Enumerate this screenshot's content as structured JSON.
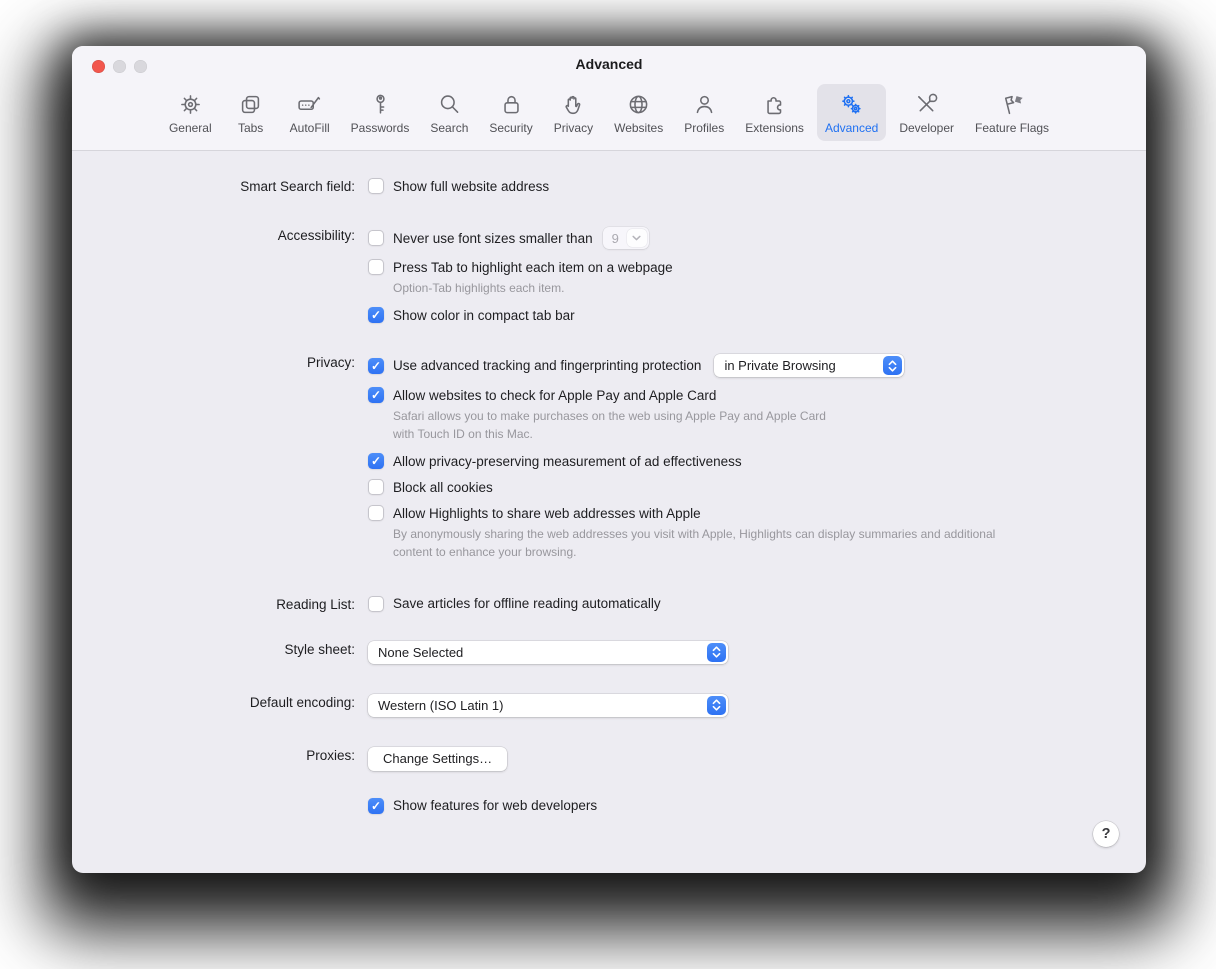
{
  "window": {
    "title": "Advanced"
  },
  "toolbar": {
    "items": [
      {
        "label": "General",
        "icon": "gear-icon",
        "selected": false
      },
      {
        "label": "Tabs",
        "icon": "tabs-icon",
        "selected": false
      },
      {
        "label": "AutoFill",
        "icon": "autofill-icon",
        "selected": false
      },
      {
        "label": "Passwords",
        "icon": "key-icon",
        "selected": false
      },
      {
        "label": "Search",
        "icon": "search-icon",
        "selected": false
      },
      {
        "label": "Security",
        "icon": "lock-icon",
        "selected": false
      },
      {
        "label": "Privacy",
        "icon": "hand-icon",
        "selected": false
      },
      {
        "label": "Websites",
        "icon": "globe-icon",
        "selected": false
      },
      {
        "label": "Profiles",
        "icon": "person-icon",
        "selected": false
      },
      {
        "label": "Extensions",
        "icon": "puzzle-icon",
        "selected": false
      },
      {
        "label": "Advanced",
        "icon": "gears-icon",
        "selected": true
      },
      {
        "label": "Developer",
        "icon": "tools-icon",
        "selected": false
      },
      {
        "label": "Feature Flags",
        "icon": "flags-icon",
        "selected": false
      }
    ]
  },
  "content": {
    "smart_search": {
      "label": "Smart Search field:",
      "checkbox": {
        "label": "Show full website address",
        "checked": false
      }
    },
    "accessibility": {
      "label": "Accessibility:",
      "items": [
        {
          "label": "Never use font sizes smaller than",
          "checked": false,
          "value": "9"
        },
        {
          "label": "Press Tab to highlight each item on a webpage",
          "checked": false,
          "caption": "Option-Tab highlights each item."
        },
        {
          "label": "Show color in compact tab bar",
          "checked": true
        }
      ]
    },
    "privacy": {
      "label": "Privacy:",
      "items": [
        {
          "label": "Use advanced tracking and fingerprinting protection",
          "checked": true,
          "dropdown_value": "in Private Browsing"
        },
        {
          "label": "Allow websites to check for Apple Pay and Apple Card",
          "checked": true,
          "caption": "Safari allows you to make purchases on the web using Apple Pay and Apple Card with Touch ID on this Mac."
        },
        {
          "label": "Allow privacy-preserving measurement of ad effectiveness",
          "checked": true
        },
        {
          "label": "Block all cookies",
          "checked": false
        },
        {
          "label": "Allow Highlights to share web addresses with Apple",
          "checked": false,
          "caption": "By anonymously sharing the web addresses you visit with Apple, Highlights can display summaries and additional content to enhance your browsing."
        }
      ]
    },
    "reading_list": {
      "label": "Reading List:",
      "checkbox": {
        "label": "Save articles for offline reading automatically",
        "checked": false
      }
    },
    "style_sheet": {
      "label": "Style sheet:",
      "value": "None Selected"
    },
    "default_encoding": {
      "label": "Default encoding:",
      "value": "Western (ISO Latin 1)"
    },
    "proxies": {
      "label": "Proxies:",
      "button_label": "Change Settings…"
    },
    "developer": {
      "checkbox": {
        "label": "Show features for web developers",
        "checked": true
      }
    },
    "help_label": "?"
  },
  "colors": {
    "accent_blue": "#2e72f3",
    "window_bg": "#edecf2",
    "header_bg": "#f5f4f9",
    "selected_tab_bg": "#e3e2e9",
    "caption_gray": "#98979d",
    "close_red": "#f2564d"
  }
}
